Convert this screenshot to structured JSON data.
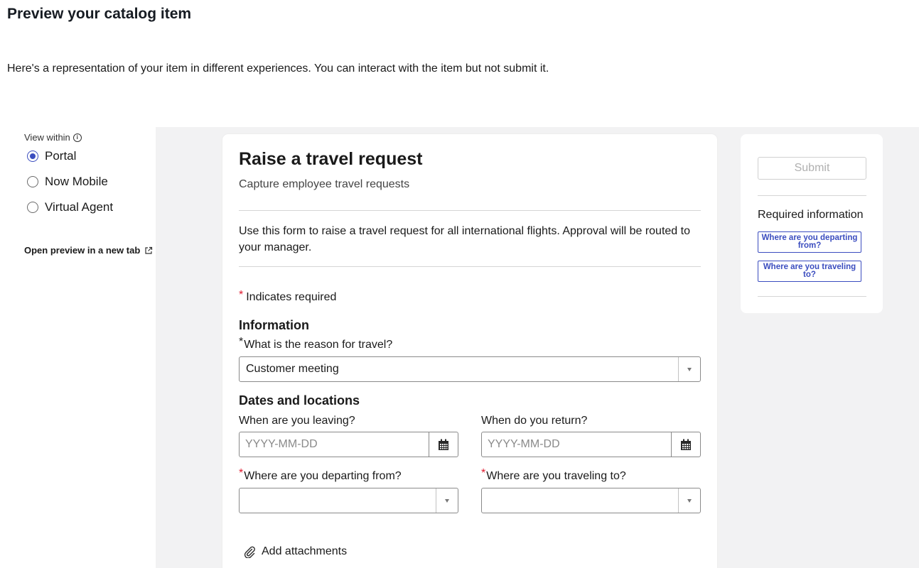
{
  "header": {
    "title": "Preview your catalog item",
    "description": "Here's a representation of your item in different experiences. You can interact with the item but not submit it."
  },
  "view_options": {
    "label": "View within",
    "options": [
      {
        "label": "Portal",
        "selected": true
      },
      {
        "label": "Now Mobile",
        "selected": false
      },
      {
        "label": "Virtual Agent",
        "selected": false
      }
    ],
    "open_preview": "Open preview in a new tab"
  },
  "form": {
    "title": "Raise a travel request",
    "subtitle": "Capture employee travel requests",
    "description": "Use this form to raise a travel request for all international flights. Approval will be routed to your manager.",
    "required_note": "Indicates required",
    "required_marker": "*",
    "section_information": "Information",
    "reason_label": "What is the reason for travel?",
    "reason_value": "Customer meeting",
    "section_dates": "Dates and locations",
    "leaving_label": "When are you leaving?",
    "leaving_placeholder": "YYYY-MM-DD",
    "return_label": "When do you return?",
    "return_placeholder": "YYYY-MM-DD",
    "departing_label": "Where are you departing from?",
    "departing_value": "",
    "destination_label": "Where are you traveling to?",
    "destination_value": "",
    "attachments_label": "Add attachments"
  },
  "side_panel": {
    "submit_label": "Submit",
    "required_info_title": "Required information",
    "required_links": [
      "Where are you departing from?",
      "Where are you traveling to?"
    ]
  },
  "colors": {
    "accent": "#3b4dbf",
    "required": "#e0182d",
    "preview_bg": "#f2f2f3"
  }
}
